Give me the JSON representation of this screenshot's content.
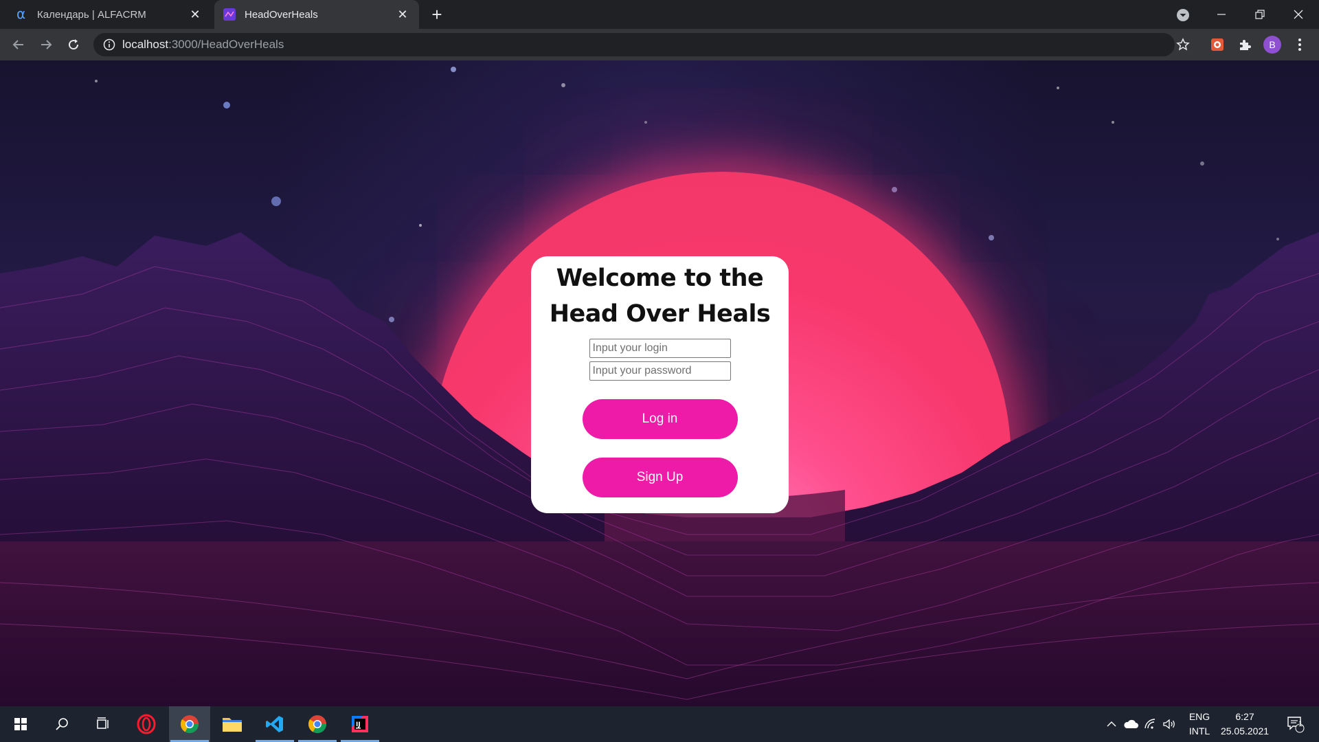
{
  "browser": {
    "tabs": [
      {
        "title": "Календарь | ALFACRM",
        "active": false
      },
      {
        "title": "HeadOverHeals",
        "active": true
      }
    ],
    "new_tab": "+",
    "url_host": "localhost",
    "url_path": ":3000/HeadOverHeals",
    "profile_initial": "B"
  },
  "login_card": {
    "heading": "Welcome to the Head Over Heals",
    "login_placeholder": "Input your login",
    "password_placeholder": "Input your password",
    "login_button": "Log in",
    "signup_button": "Sign Up"
  },
  "taskbar": {
    "language_line1": "ENG",
    "language_line2": "INTL",
    "time": "6:27",
    "date": "25.05.2021",
    "notification_count": "1"
  },
  "colors": {
    "accent_button": "#ee1aa8",
    "sun": "#f7386c",
    "chrome_dark": "#202124",
    "chrome_toolbar": "#35363a",
    "taskbar": "#1d2430"
  }
}
